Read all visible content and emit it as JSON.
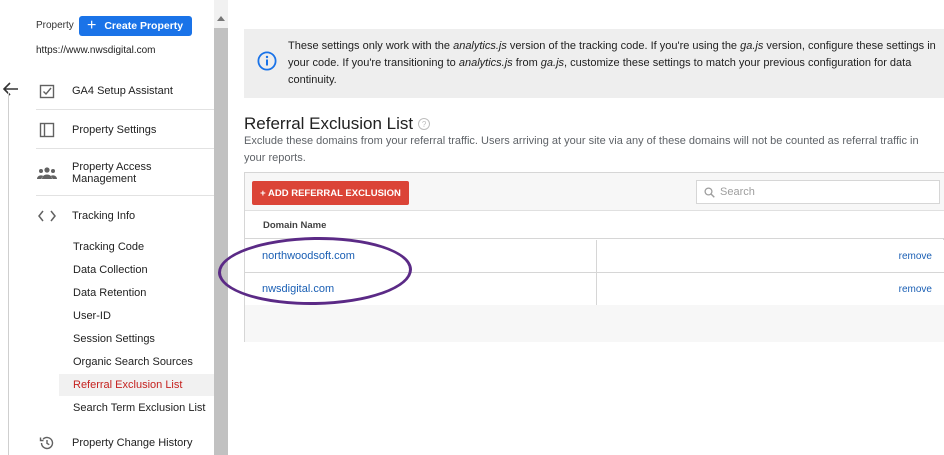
{
  "sidebar": {
    "property_label": "Property",
    "create_button": "Create Property",
    "property_url": "https://www.nwsdigital.com",
    "items": [
      {
        "label": "GA4 Setup Assistant",
        "icon": "checkbox-icon"
      },
      {
        "label": "Property Settings",
        "icon": "layout-icon"
      },
      {
        "label": "Property Access Management",
        "icon": "people-icon"
      },
      {
        "label": "Tracking Info",
        "icon": "code-icon"
      }
    ],
    "sub_items": [
      {
        "label": "Tracking Code"
      },
      {
        "label": "Data Collection"
      },
      {
        "label": "Data Retention"
      },
      {
        "label": "User-ID"
      },
      {
        "label": "Session Settings"
      },
      {
        "label": "Organic Search Sources"
      },
      {
        "label": "Referral Exclusion List",
        "active": true
      },
      {
        "label": "Search Term Exclusion List"
      }
    ],
    "history_item": {
      "label": "Property Change History",
      "icon": "history-icon"
    }
  },
  "info": {
    "t1": "These settings only work with the ",
    "t2": "analytics.js",
    "t3": " version of the tracking code. If you're using the ",
    "t4": "ga.js",
    "t5": " version, configure these settings in your code. If you're transitioning to ",
    "t6": "analytics.js",
    "t7": " from ",
    "t8": "ga.js",
    "t9": ", customize these settings to match your previous configuration for data continuity."
  },
  "main": {
    "title": "Referral Exclusion List",
    "help": "?",
    "description": "Exclude these domains from your referral traffic. Users arriving at your site via any of these domains will not be counted as referral traffic in your reports.",
    "add_button": "+ ADD REFERRAL EXCLUSION",
    "search_placeholder": "Search",
    "column_header": "Domain Name",
    "rows": [
      {
        "domain": "northwoodsoft.com",
        "action": "remove"
      },
      {
        "domain": "nwsdigital.com",
        "action": "remove"
      }
    ]
  },
  "colors": {
    "accent": "#1a73e8",
    "add_button": "#db4437",
    "active_nav": "#c5221f",
    "link": "#1a5fb4",
    "annotation": "#5b2a86"
  }
}
